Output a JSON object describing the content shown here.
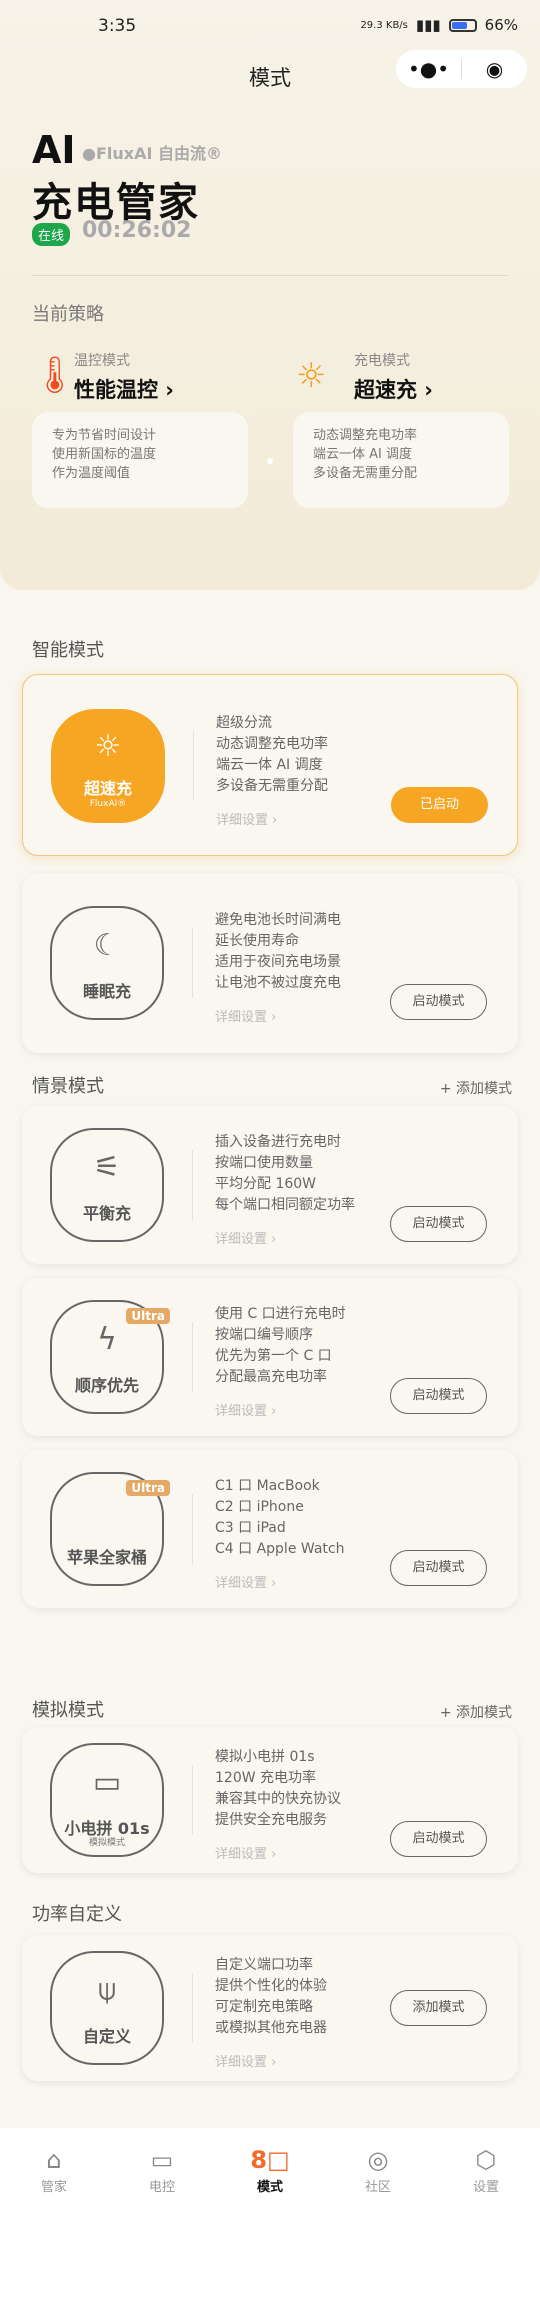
{
  "status": {
    "time": "3:35",
    "net": "29.3 KB/s",
    "battery": "66%",
    "battery_level": 0.66
  },
  "nav": {
    "title": "模式",
    "more": "•●•",
    "target": "◉"
  },
  "hero": {
    "ai": "AI",
    "brand": "●FluxAI 自由流®",
    "title": "充电管家",
    "online": "在线",
    "timer": "00:26:02"
  },
  "strategy": {
    "label": "当前策略",
    "temp": {
      "sub": "温控模式",
      "main": "性能温控 ›",
      "lines": [
        "专为节省时间设计",
        "使用新国标的温度",
        "作为温度阈值"
      ]
    },
    "charge": {
      "sub": "充电模式",
      "main": "超速充 ›",
      "lines": [
        "动态调整充电功率",
        "端云一体 AI 调度",
        "多设备无需重分配"
      ]
    }
  },
  "sections": {
    "smart": "智能模式",
    "scene": "情景模式",
    "sim": "模拟模式",
    "custom": "功率自定义",
    "add": "+ 添加模式"
  },
  "detail": "详细设置 ›",
  "cards": [
    {
      "name": "超速充",
      "sub": "FluxAI®",
      "icon": "sun-bolt",
      "lines": [
        "超级分流",
        "动态调整充电功率",
        "端云一体 AI 调度",
        "多设备无需重分配"
      ],
      "button": "已启动"
    },
    {
      "name": "睡眠充",
      "icon": "moon",
      "lines": [
        "避免电池长时间满电",
        "延长使用寿命",
        "适用于夜间充电场景",
        "让电池不被过度充电"
      ],
      "button": "启动模式"
    },
    {
      "name": "平衡充",
      "icon": "sliders",
      "lines": [
        "插入设备进行充电时",
        "按端口使用数量",
        "平均分配 160W",
        "每个端口相同额定功率"
      ],
      "button": "启动模式"
    },
    {
      "name": "顺序优先",
      "badge": "Ultra",
      "icon": "bolt-plus",
      "lines": [
        "使用 C 口进行充电时",
        "按端口编号顺序",
        "优先为第一个 C 口",
        "分配最高充电功率"
      ],
      "button": "启动模式"
    },
    {
      "name": "苹果全家桶",
      "badge": "Ultra",
      "icon": "apple",
      "lines": [
        "C1 口 MacBook",
        "C2 口 iPhone",
        "C3 口 iPad",
        "C4 口 Apple Watch"
      ],
      "button": "启动模式"
    },
    {
      "name": "小电拼 01s",
      "sub": "模拟模式",
      "icon": "device-01s",
      "lines": [
        "模拟小电拼 01s",
        "120W 充电功率",
        "兼容其中的快充协议",
        "提供安全充电服务"
      ],
      "button": "启动模式"
    },
    {
      "name": "自定义",
      "icon": "custom-node",
      "lines": [
        "自定义端口功率",
        "提供个性化的体验",
        "可定制充电策略",
        "或模拟其他充电器"
      ],
      "button": "添加模式"
    }
  ],
  "tabs": [
    {
      "label": "管家",
      "icon": "⌂"
    },
    {
      "label": "电控",
      "icon": "▭"
    },
    {
      "label": "模式",
      "icon": "8□"
    },
    {
      "label": "社区",
      "icon": "◎"
    },
    {
      "label": "设置",
      "icon": "⬡"
    }
  ],
  "colors": {
    "accent": "#f6a623",
    "online": "#1ea64a",
    "active_tab": "#f26a2c"
  }
}
